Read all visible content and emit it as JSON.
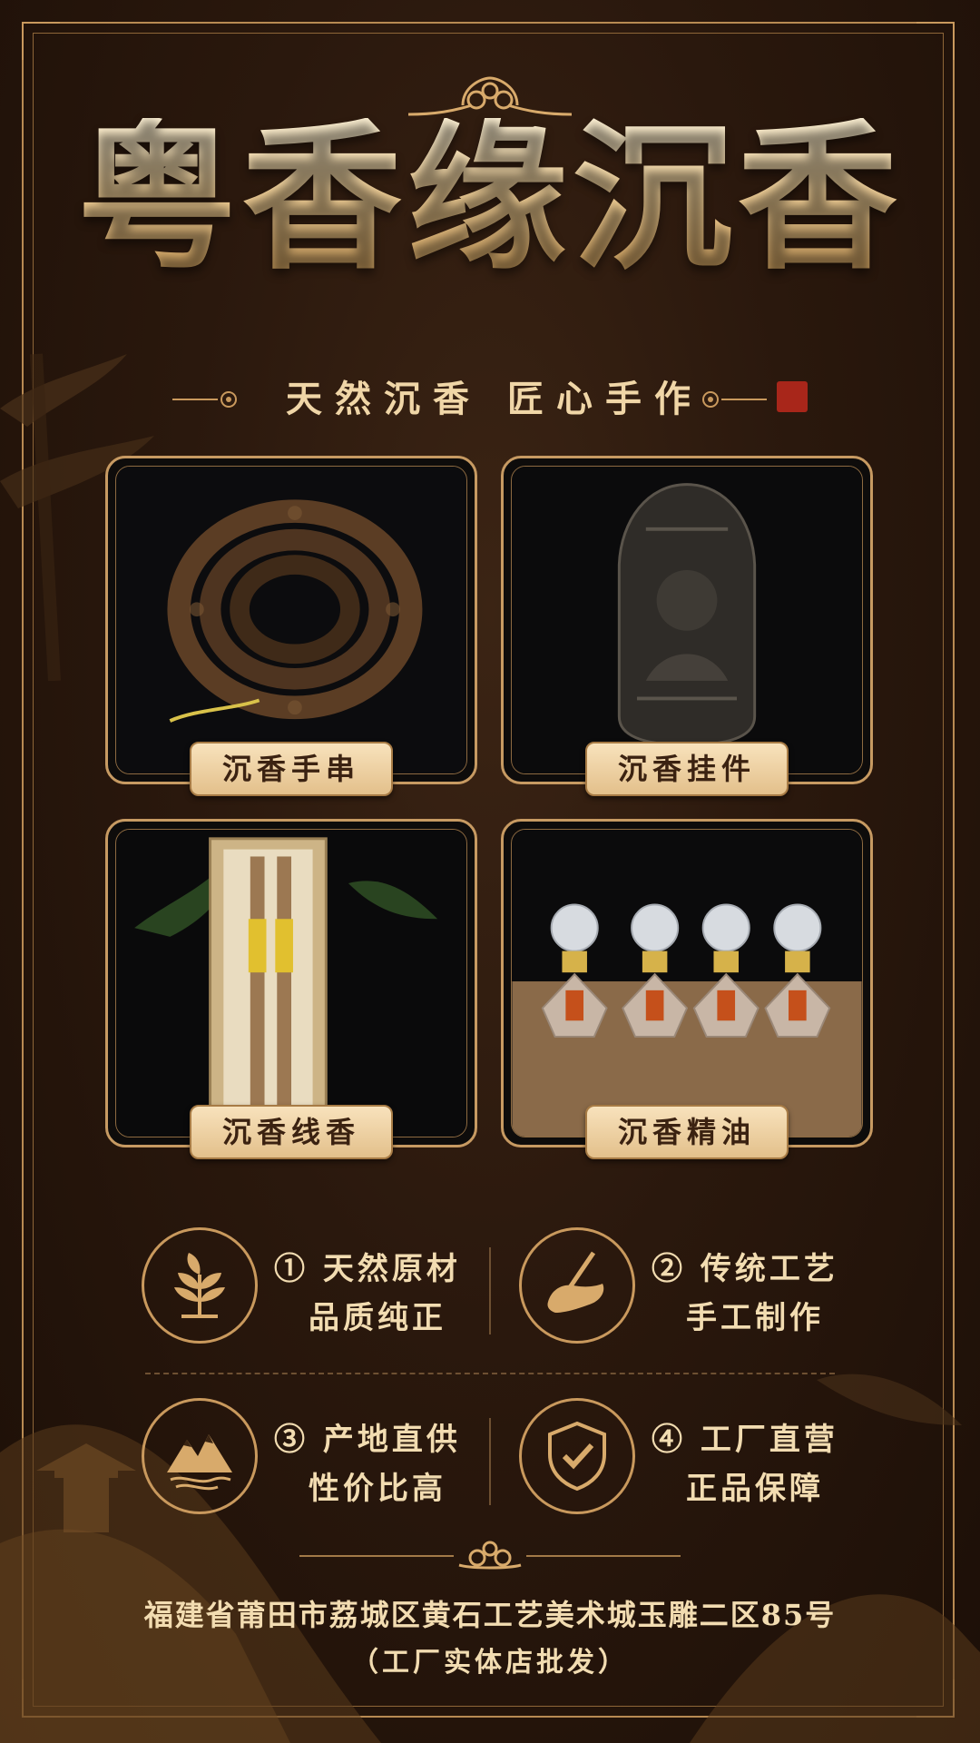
{
  "header": {
    "brand": "粤香缘沉香",
    "slogan": "天然沉香  匠心手作"
  },
  "products": [
    {
      "label": "沉香手串",
      "icon": "bead-bracelet"
    },
    {
      "label": "沉香挂件",
      "icon": "buddha-pendant"
    },
    {
      "label": "沉香线香",
      "icon": "incense-sticks"
    },
    {
      "label": "沉香精油",
      "icon": "oil-bottles"
    }
  ],
  "features": [
    {
      "line1": "① 天然原材",
      "line2": "品质纯正",
      "icon": "sprout-icon"
    },
    {
      "line1": "② 传统工艺",
      "line2": "手工制作",
      "icon": "hand-brush-icon"
    },
    {
      "line1": "③ 产地直供",
      "line2": "性价比高",
      "icon": "mountain-icon"
    },
    {
      "line1": "④ 工厂直营",
      "line2": "正品保障",
      "icon": "shield-check-icon"
    }
  ],
  "footer": {
    "address": "福建省莆田市荔城区黄石工艺美术城玉雕二区85号",
    "note": "（工厂实体店批发）"
  },
  "colors": {
    "background": "#2a180d",
    "gold": "#c9995d",
    "label_bg": "#e3c08b",
    "text": "#f2dcb1"
  }
}
